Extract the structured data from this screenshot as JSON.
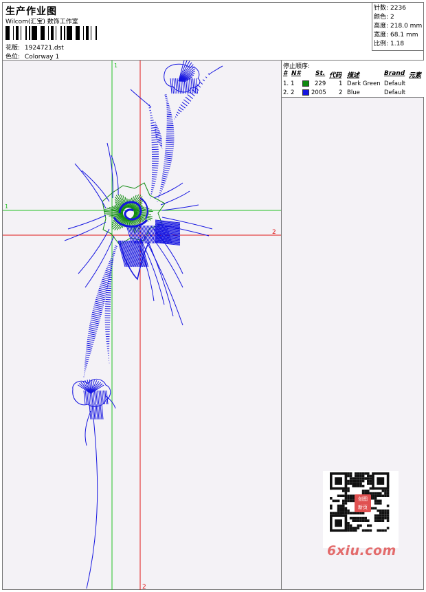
{
  "header": {
    "title": "生产作业图",
    "company": "Wilcom(汇宝) 数饰工作室",
    "design_label": "花版:",
    "design_value": "1924721.dst",
    "colorway_label": "色位:",
    "colorway_value": "Colorway 1"
  },
  "stats": [
    {
      "label": "针数:",
      "value": "2236"
    },
    {
      "label": "颜色:",
      "value": "2"
    },
    {
      "label": "高度:",
      "value": "218.0 mm"
    },
    {
      "label": "宽度:",
      "value": "68.1 mm"
    },
    {
      "label": "比例:",
      "value": "1.18"
    }
  ],
  "canvas": {
    "guide_label_green_left": "1",
    "guide_label_green_top": "1",
    "guide_label_red_right": "2",
    "guide_label_red_bottom": "2"
  },
  "stop_sequence": {
    "title": "停止顺序:",
    "columns": {
      "num": "#",
      "needle": "N#",
      "stitches": "St.",
      "code": "代码",
      "desc": "描述",
      "brand": "Brand",
      "element": "元素"
    },
    "rows": [
      {
        "index": "1.",
        "needle": "1",
        "color": "#0f8a0f",
        "stitches": "229",
        "code": "1",
        "desc": "Dark Green",
        "brand": "Default"
      },
      {
        "index": "2.",
        "needle": "2",
        "color": "#1414e0",
        "stitches": "2005",
        "code": "2",
        "desc": "Blue",
        "brand": "Default"
      }
    ]
  },
  "watermark": {
    "text": "6xiu.com",
    "seal_top": "创图",
    "seal_bottom": "新页"
  },
  "colors": {
    "guide_green": "#22c022",
    "guide_red": "#e01818",
    "thread_blue": "#1414e0",
    "thread_green": "#0f8a0f"
  }
}
